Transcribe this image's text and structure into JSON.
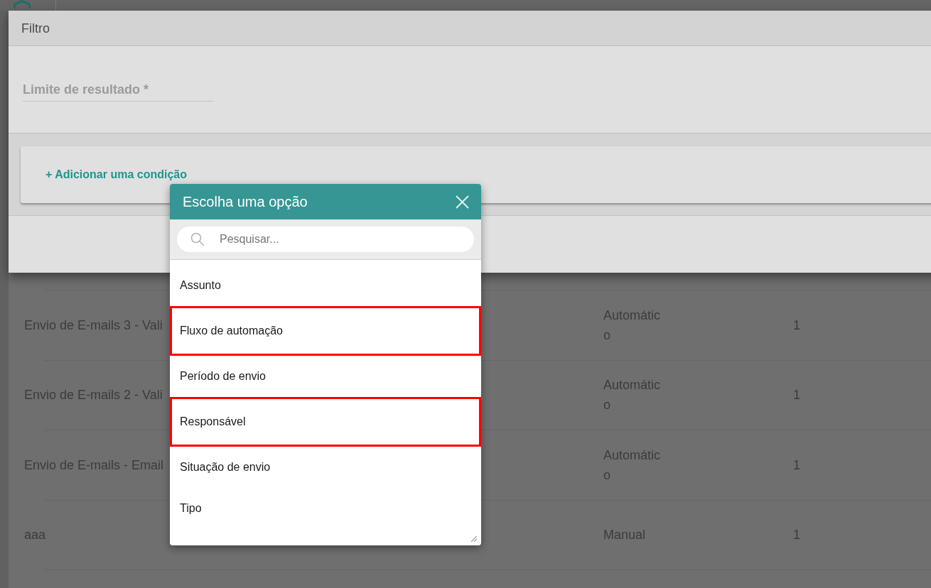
{
  "table": {
    "rows": [
      {
        "column_1": "Envio de E-mails 3 - Vali",
        "column_2": "Automático",
        "column_3": "1"
      },
      {
        "column_1": "Envio de E-mails 2 - Vali",
        "column_2": "Automático",
        "column_3": "1"
      },
      {
        "column_1": "Envio de E-mails - Email",
        "column_2": "Automático",
        "column_3": "1"
      },
      {
        "column_1": "aaa",
        "column_2": "Manual",
        "column_3": "1"
      }
    ]
  },
  "filter_modal": {
    "title": "Filtro",
    "result_limit": {
      "placeholder": "Limite de resultado *"
    },
    "add_condition_link": "+ Adicionar uma condição"
  },
  "option_picker": {
    "title": "Escolha uma opção",
    "search": {
      "placeholder": "Pesquisar..."
    },
    "options": [
      {
        "label": "Assunto",
        "highlighted": false
      },
      {
        "label": "Fluxo de automação",
        "highlighted": true
      },
      {
        "label": "Período de envio",
        "highlighted": false
      },
      {
        "label": "Responsável",
        "highlighted": true
      },
      {
        "label": "Situação de envio",
        "highlighted": false
      },
      {
        "label": "Tipo",
        "highlighted": false
      }
    ]
  }
}
